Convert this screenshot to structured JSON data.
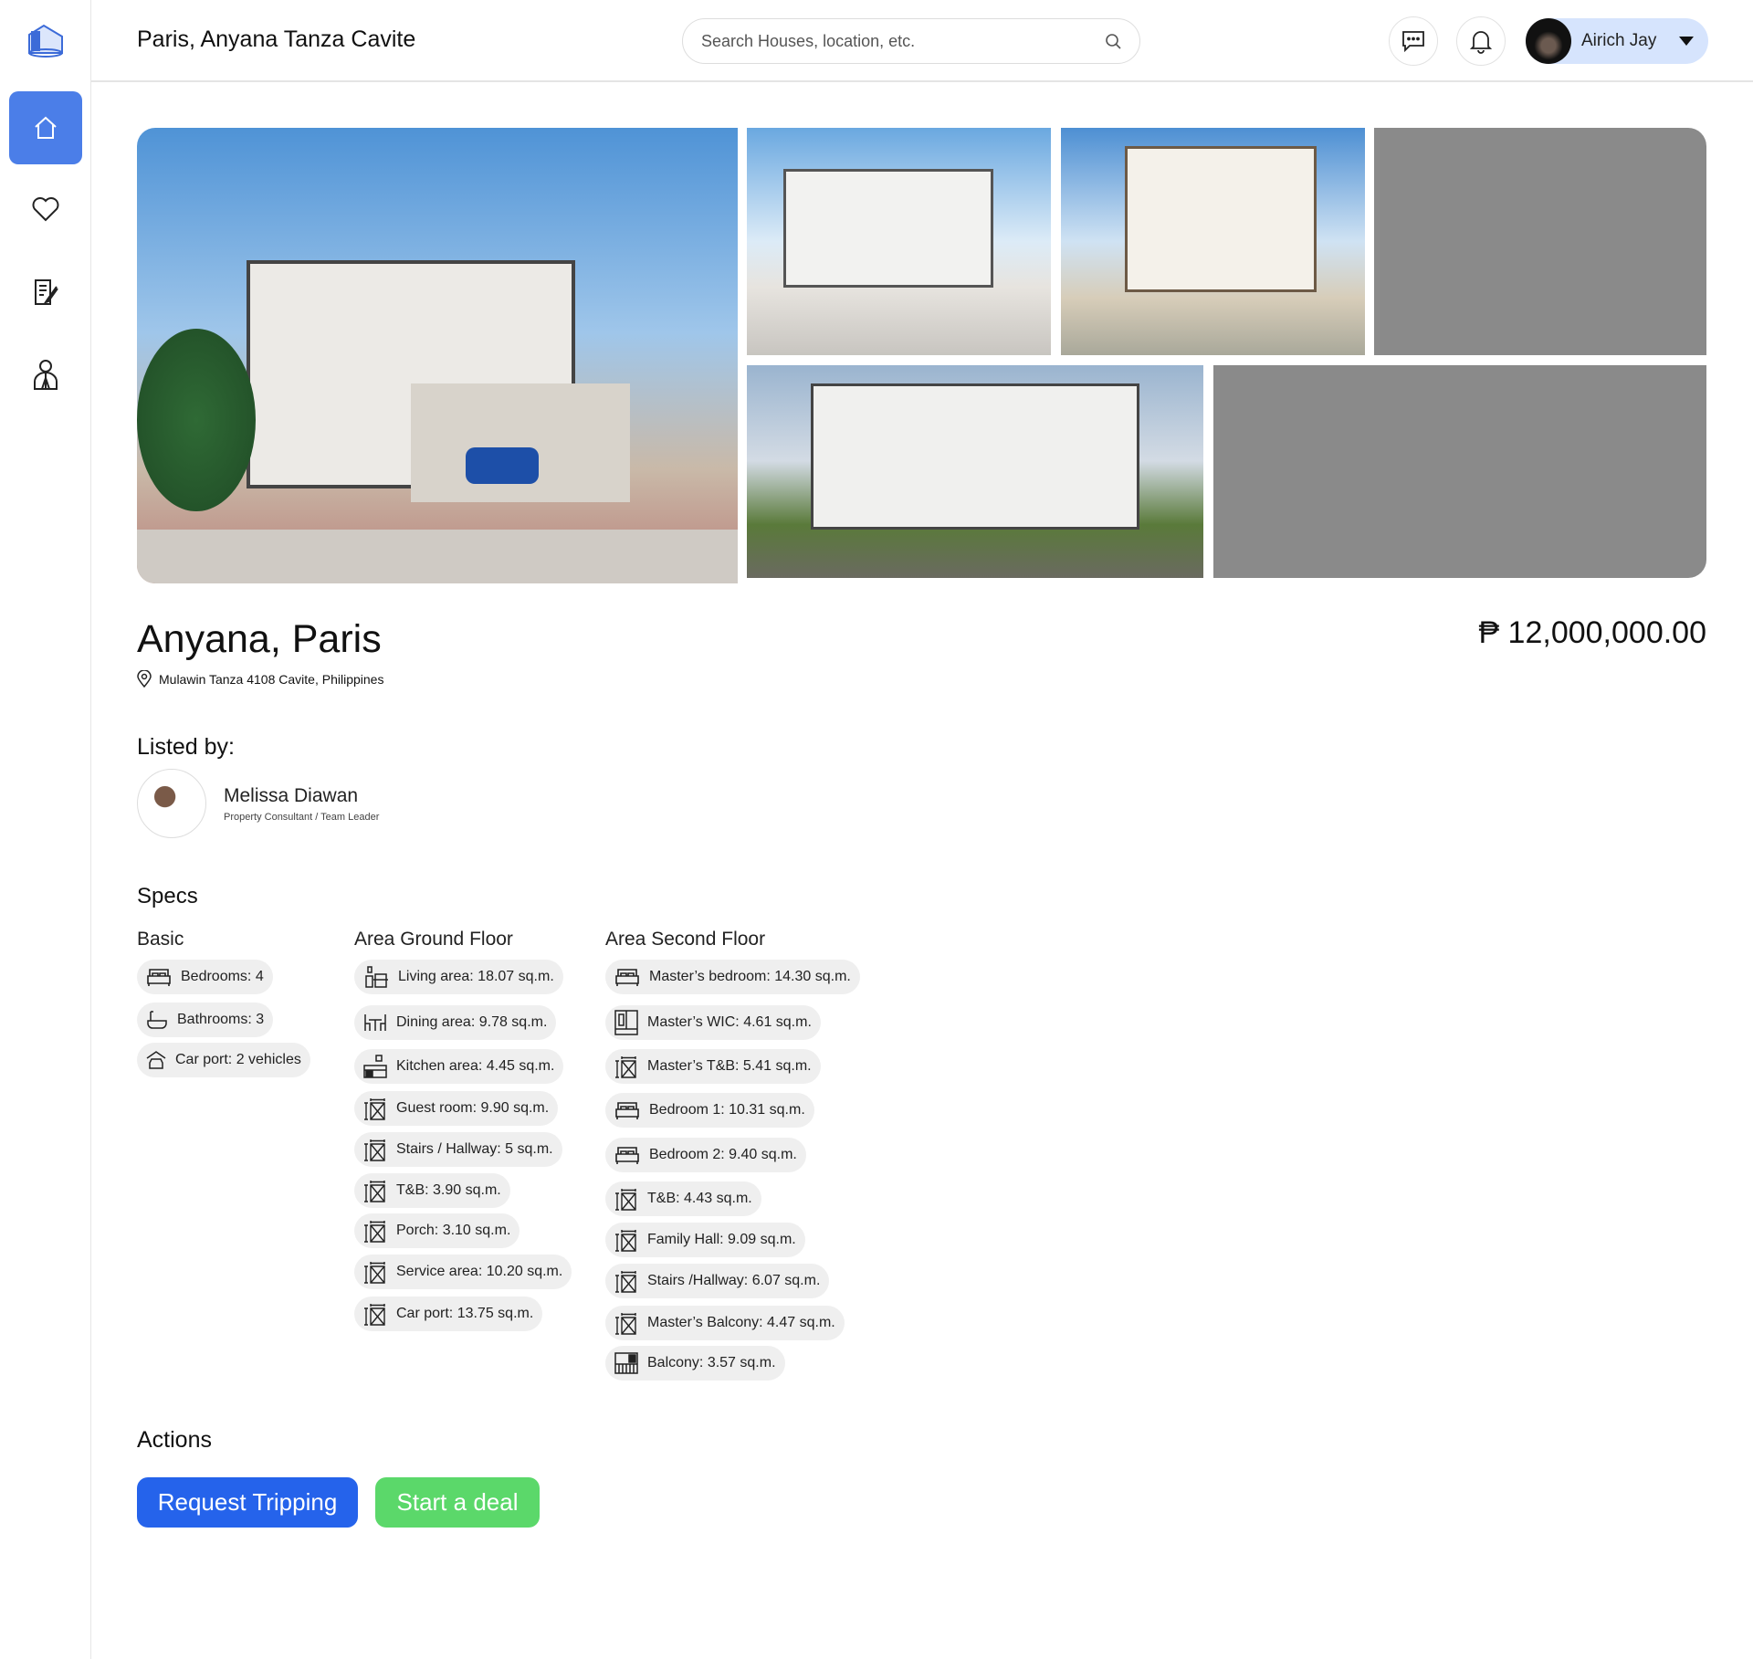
{
  "header": {
    "title": "Paris, Anyana Tanza Cavite",
    "search_placeholder": "Search Houses, location, etc.",
    "user_name": "Airich Jay"
  },
  "sidebar": {
    "items": [
      {
        "icon": "home-icon",
        "active": true
      },
      {
        "icon": "heart-icon"
      },
      {
        "icon": "document-edit-icon"
      },
      {
        "icon": "agent-icon"
      }
    ]
  },
  "colors": {
    "accent": "#4b7ee8",
    "primary_button": "#2563eb",
    "deal_button": "#5bd86a",
    "chip_bg": "#efefef"
  },
  "property": {
    "name": "Anyana, Paris",
    "address": "Mulawin Tanza 4108 Cavite, Philippines",
    "price": "₱ 12,000,000.00"
  },
  "listed_by": {
    "heading": "Listed by:",
    "name": "Melissa Diawan",
    "role": "Property Consultant / Team Leader"
  },
  "specs": {
    "heading": "Specs",
    "basic": {
      "title": "Basic",
      "items": [
        "Bedrooms: 4",
        "Bathrooms: 3",
        "Car port: 2 vehicles"
      ]
    },
    "ground": {
      "title": "Area Ground Floor",
      "items": [
        "Living area: 18.07 sq.m.",
        "Dining area: 9.78 sq.m.",
        "Kitchen area: 4.45 sq.m.",
        "Guest room: 9.90 sq.m.",
        "Stairs / Hallway: 5 sq.m.",
        "T&B: 3.90 sq.m.",
        "Porch: 3.10 sq.m.",
        "Service area: 10.20 sq.m.",
        "Car port: 13.75 sq.m."
      ]
    },
    "second": {
      "title": "Area Second Floor",
      "items": [
        "Master’s bedroom: 14.30 sq.m.",
        "Master’s WIC: 4.61 sq.m.",
        "Master’s T&B: 5.41 sq.m.",
        "Bedroom 1: 10.31 sq.m.",
        "Bedroom 2: 9.40 sq.m.",
        "T&B: 4.43 sq.m.",
        "Family Hall: 9.09 sq.m.",
        "Stairs /Hallway: 6.07 sq.m.",
        "Master’s Balcony: 4.47 sq.m.",
        "Balcony: 3.57 sq.m."
      ]
    }
  },
  "actions": {
    "heading": "Actions",
    "request": "Request Tripping",
    "deal": "Start a deal"
  }
}
